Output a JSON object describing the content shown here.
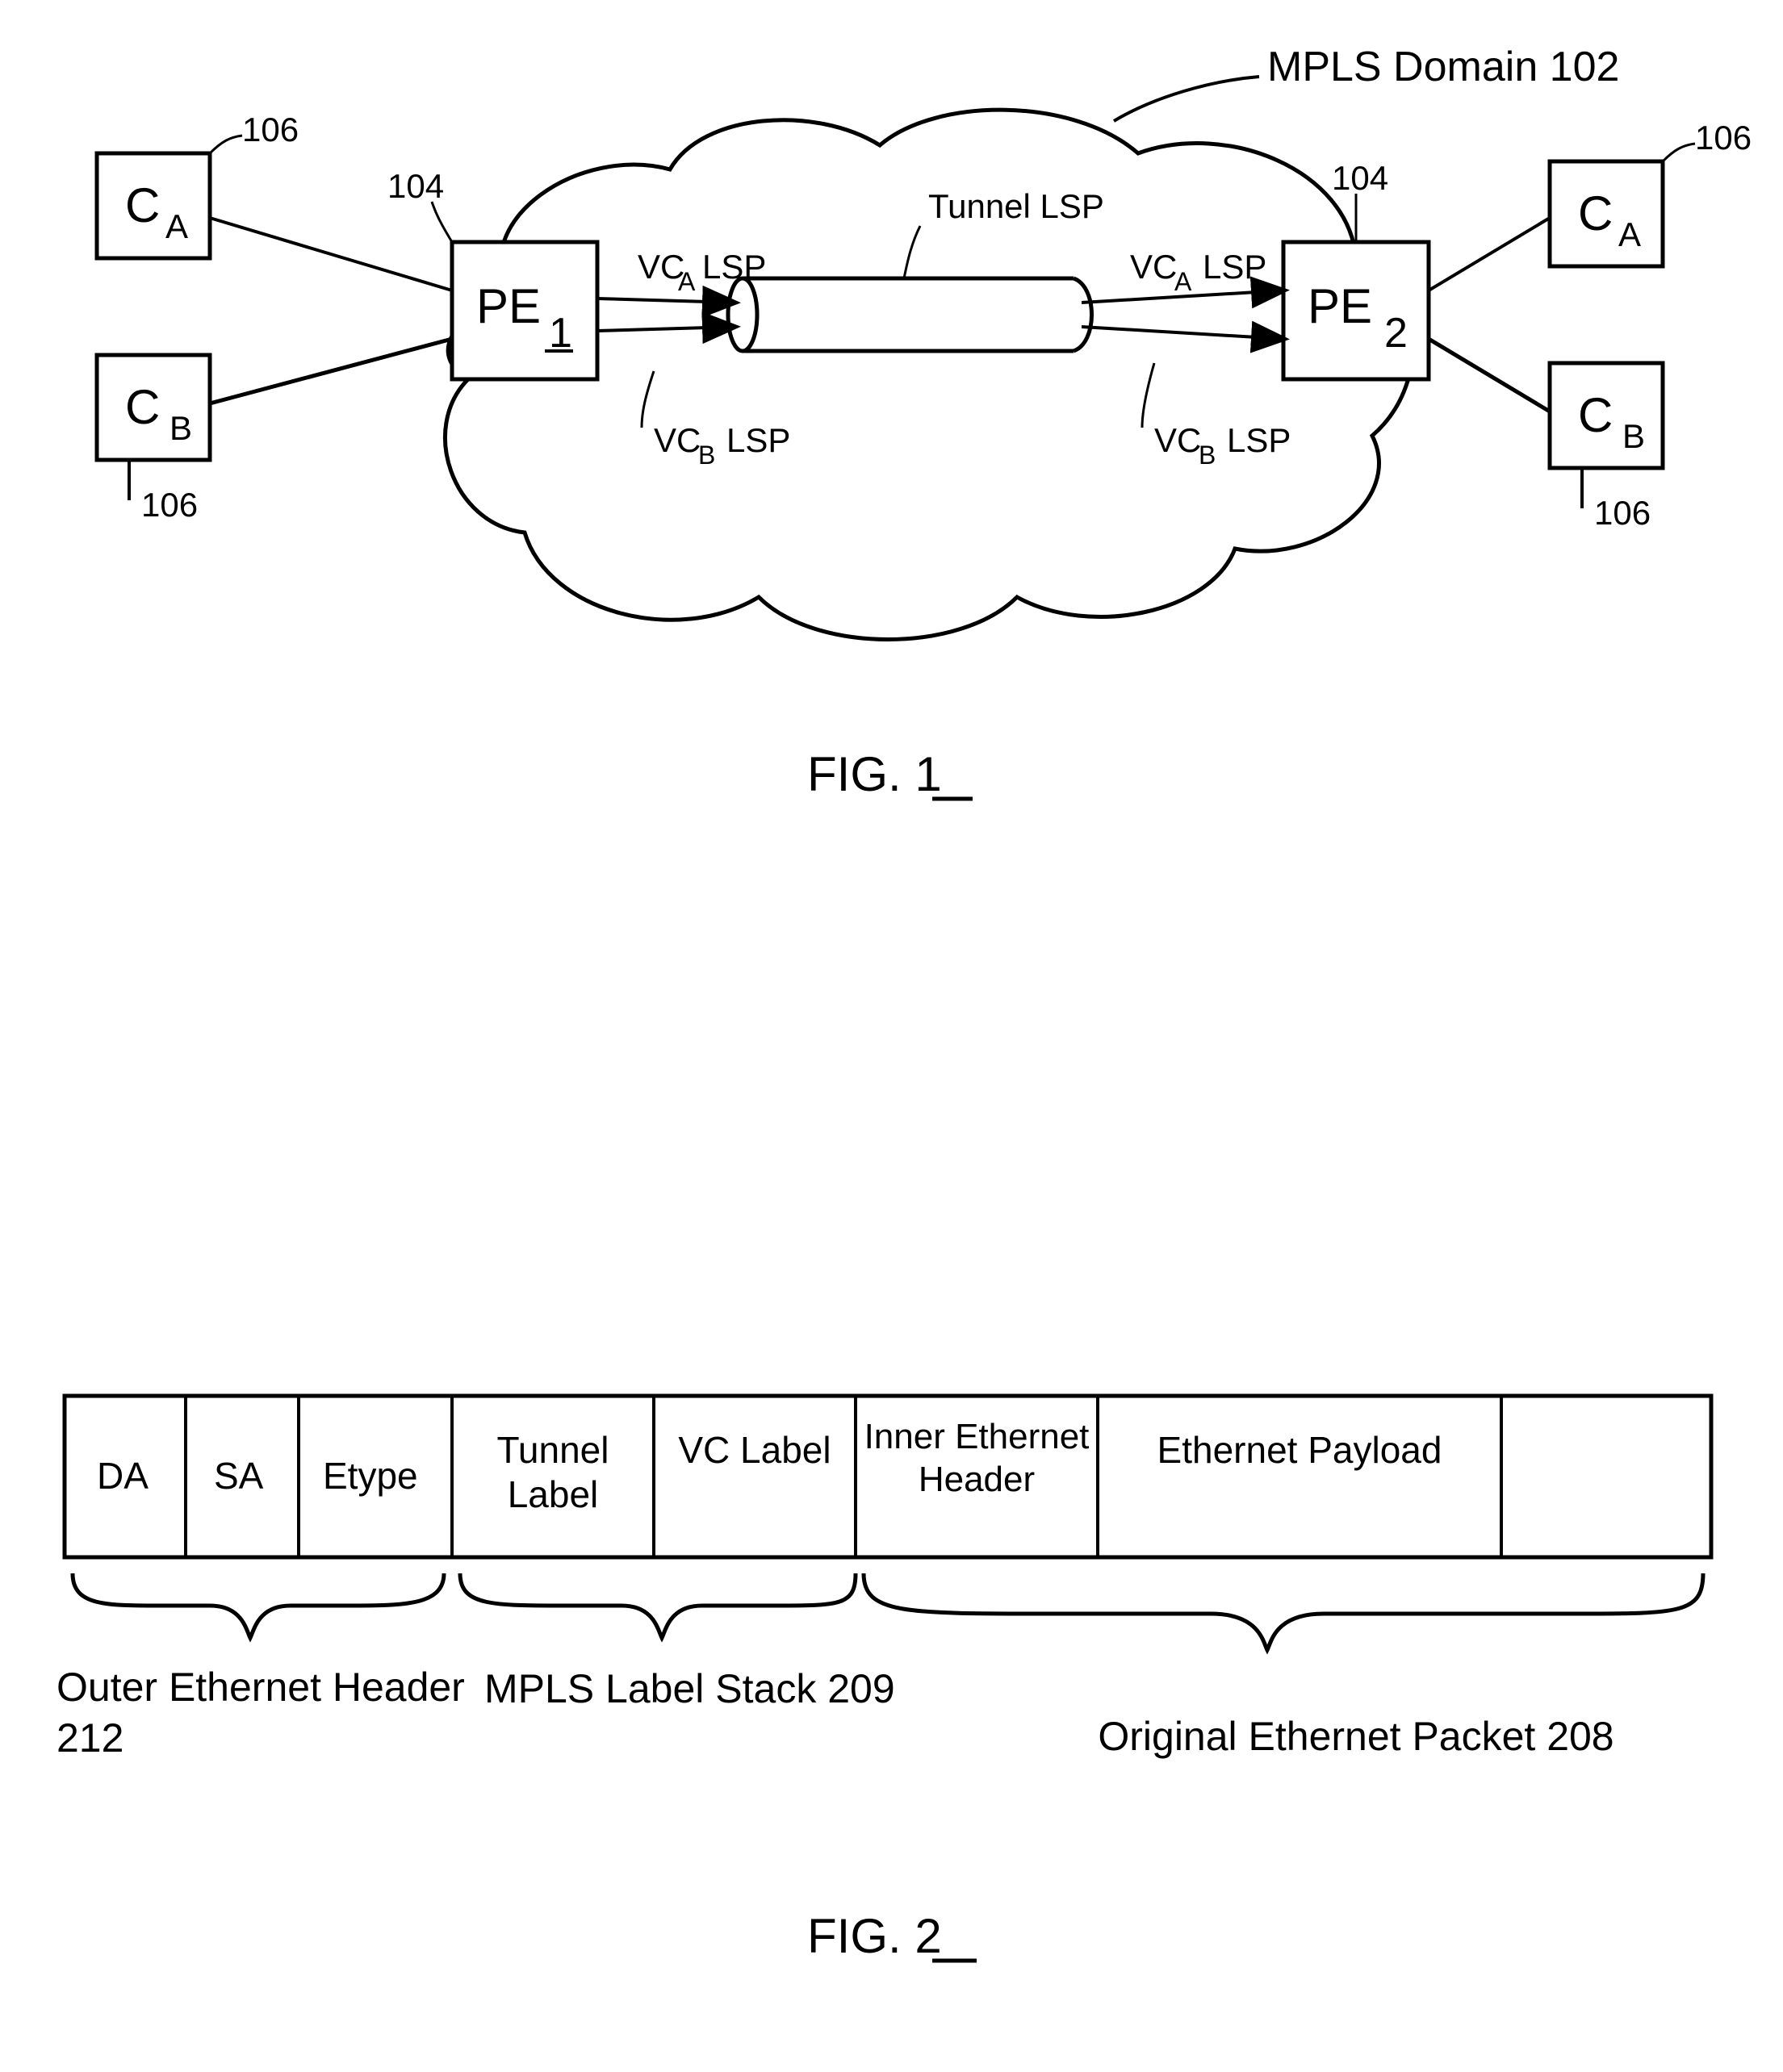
{
  "fig1": {
    "domain_label": "MPLS Domain 102",
    "pe1": {
      "label": "PE",
      "sub": "1",
      "ref": "104"
    },
    "pe2": {
      "label": "PE",
      "sub": "2",
      "ref": "104"
    },
    "ca_left": {
      "label": "C",
      "sub": "A",
      "ref": "106"
    },
    "cb_left": {
      "label": "C",
      "sub": "B",
      "ref": "106"
    },
    "ca_right": {
      "label": "C",
      "sub": "A",
      "ref": "106"
    },
    "cb_right": {
      "label": "C",
      "sub": "B",
      "ref": "106"
    },
    "tunnel_label": "Tunnel LSP",
    "vca_left": "LSP",
    "vcb_left": "LSP",
    "vca_right": "LSP",
    "vcb_right": "LSP",
    "caption": "FIG. 1"
  },
  "fig2": {
    "cells": {
      "da": "DA",
      "sa": "SA",
      "etype": "Etype",
      "tunnel": "Tunnel Label",
      "vc": "VC Label",
      "inner": "Inner Ethernet Header",
      "payload": "Ethernet Payload"
    },
    "braces": {
      "outer": "Outer Ethernet Header 212",
      "mpls": "MPLS Label Stack 209",
      "orig": "Original Ethernet Packet 208"
    },
    "caption": "FIG. 2"
  }
}
